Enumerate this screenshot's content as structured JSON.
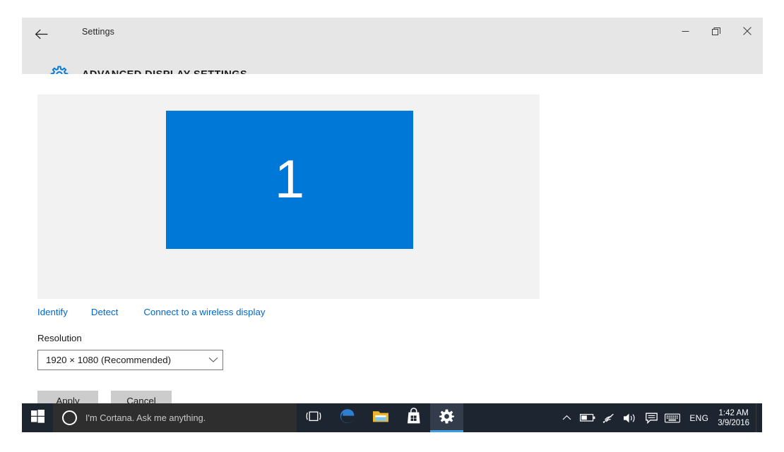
{
  "window": {
    "app_title": "Settings",
    "back_icon": "back-arrow-icon",
    "page_icon": "gear-icon",
    "page_title": "ADVANCED DISPLAY SETTINGS",
    "controls": {
      "minimize": "minimize-icon",
      "restore": "restore-icon",
      "close": "close-icon"
    }
  },
  "display": {
    "monitor_number": "1",
    "monitor_color": "#0078d7",
    "preview_background": "#f2f2f2"
  },
  "links": [
    {
      "label": "Identify"
    },
    {
      "label": "Detect"
    },
    {
      "label": "Connect to a wireless display"
    }
  ],
  "resolution": {
    "label": "Resolution",
    "value": "1920 × 1080 (Recommended)",
    "chevron": "chevron-down-icon"
  },
  "actions": {
    "apply": "Apply",
    "cancel": "Cancel"
  },
  "taskbar": {
    "start_icon": "windows-logo-icon",
    "cortana_placeholder": "I'm Cortana. Ask me anything.",
    "cortana_icon": "cortana-circle-icon",
    "taskview_icon": "task-view-icon",
    "apps": [
      {
        "name": "edge-icon",
        "label": "Microsoft Edge",
        "active": false
      },
      {
        "name": "file-explorer-icon",
        "label": "File Explorer",
        "active": false
      },
      {
        "name": "store-icon",
        "label": "Store",
        "active": false
      },
      {
        "name": "settings-gear-icon",
        "label": "Settings",
        "active": true
      }
    ],
    "tray": {
      "chevron": "chevron-up-icon",
      "battery": "battery-icon",
      "network": "wifi-icon",
      "volume": "speaker-icon",
      "action_center": "action-center-icon",
      "keyboard": "keyboard-icon",
      "language": "ENG",
      "time": "1:42 AM",
      "date": "3/9/2016"
    },
    "accent_color": "#3a9fe6",
    "background": "#1d2531"
  }
}
